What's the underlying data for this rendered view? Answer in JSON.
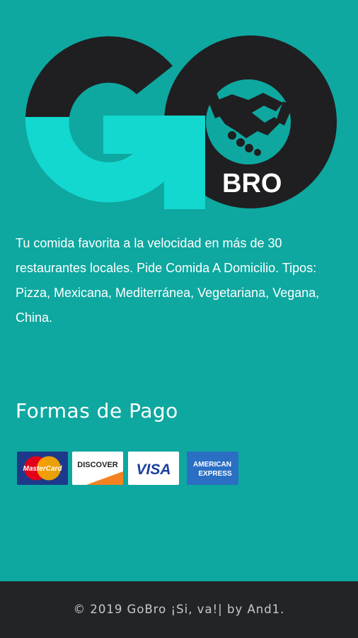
{
  "brand": {
    "logo_letters": "GO",
    "logo_sub": "BRO",
    "colors": {
      "background": "#0fa8a0",
      "logo_dark": "#1f1f21",
      "logo_cyan": "#12d8cf",
      "footer": "#232426"
    }
  },
  "tagline": "Tu comida favorita a la velocidad en más de 30 restaurantes locales. Pide Comida A Domicilio. Tipos: Pizza, Mexicana, Mediterránea, Vegetariana, Vegana, China.",
  "payment": {
    "title": "Formas de Pago",
    "cards": [
      {
        "name": "mastercard",
        "label": "MasterCard"
      },
      {
        "name": "discover",
        "label": "DISCOVER"
      },
      {
        "name": "visa",
        "label": "VISA"
      },
      {
        "name": "amex",
        "label_top": "AMERICAN",
        "label_bottom": "EXPRESS"
      }
    ]
  },
  "footer": {
    "text": "© 2019 GoBro ¡Si, va!| by And1."
  }
}
